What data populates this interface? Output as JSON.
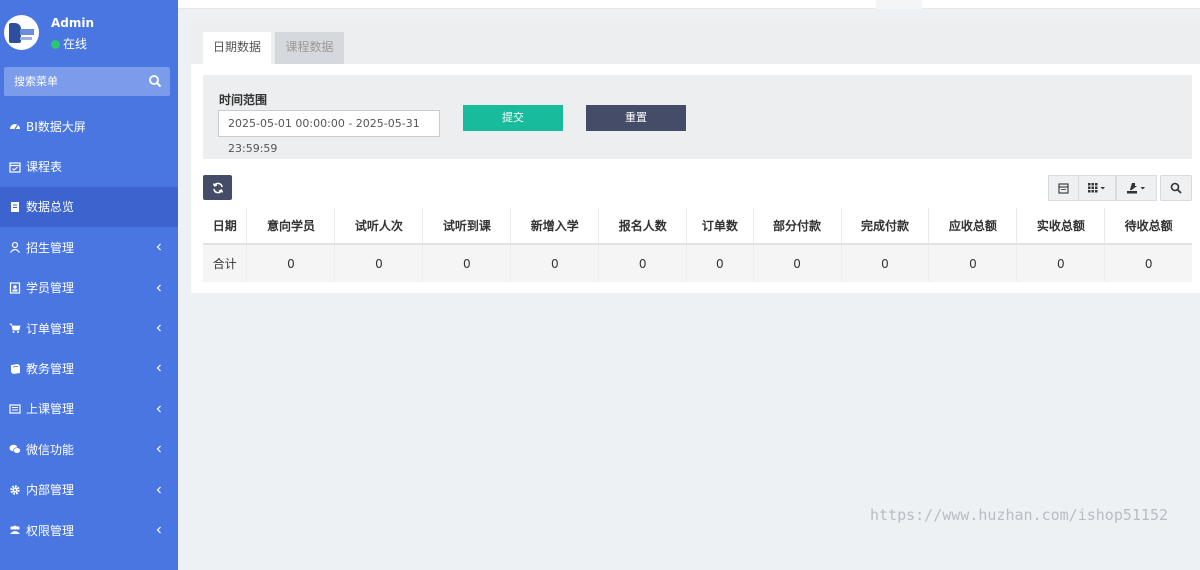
{
  "sidebar": {
    "user": {
      "name": "Admin",
      "status": "在线",
      "status_color": "#29c76f"
    },
    "search": {
      "placeholder": "搜索菜单"
    },
    "items": [
      {
        "label": "BI数据大屏",
        "icon": "dashboard-icon",
        "active": false,
        "has_arrow": false
      },
      {
        "label": "课程表",
        "icon": "calendar-icon",
        "active": false,
        "has_arrow": false
      },
      {
        "label": "数据总览",
        "icon": "book-icon",
        "active": true,
        "has_arrow": false
      },
      {
        "label": "招生管理",
        "icon": "user-icon",
        "active": false,
        "has_arrow": true
      },
      {
        "label": "学员管理",
        "icon": "portrait-icon",
        "active": false,
        "has_arrow": true
      },
      {
        "label": "订单管理",
        "icon": "cart-icon",
        "active": false,
        "has_arrow": true
      },
      {
        "label": "教务管理",
        "icon": "book-open-icon",
        "active": false,
        "has_arrow": true
      },
      {
        "label": "上课管理",
        "icon": "list-alt-icon",
        "active": false,
        "has_arrow": true
      },
      {
        "label": "微信功能",
        "icon": "wechat-icon",
        "active": false,
        "has_arrow": true
      },
      {
        "label": "内部管理",
        "icon": "gear-icon",
        "active": false,
        "has_arrow": true
      },
      {
        "label": "权限管理",
        "icon": "group-icon",
        "active": false,
        "has_arrow": true
      }
    ]
  },
  "tabs": [
    {
      "label": "日期数据",
      "active": true
    },
    {
      "label": "课程数据",
      "active": false
    }
  ],
  "filter": {
    "label": "时间范围",
    "date_range": "2025-05-01 00:00:00 - 2025-05-31 23:59:59",
    "submit_label": "提交",
    "reset_label": "重置"
  },
  "table": {
    "columns": [
      "日期",
      "意向学员",
      "试听人次",
      "试听到课",
      "新增入学",
      "报名人数",
      "订单数",
      "部分付款",
      "完成付款",
      "应收总额",
      "实收总额",
      "待收总额"
    ],
    "rows": [
      [
        "合计",
        "0",
        "0",
        "0",
        "0",
        "0",
        "0",
        "0",
        "0",
        "0",
        "0",
        "0"
      ]
    ]
  },
  "watermark": "https://www.huzhan.com/ishop51152",
  "colors": {
    "sidebar": "#4a76e2",
    "sidebar_active": "#3d63cf",
    "submit": "#18bc9c",
    "dark_button": "#444c68"
  }
}
